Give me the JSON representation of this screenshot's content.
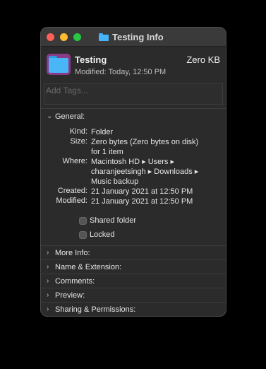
{
  "window": {
    "title": "Testing Info"
  },
  "header": {
    "name": "Testing",
    "size": "Zero KB",
    "modified": "Modified: Today, 12:50 PM"
  },
  "tags": {
    "placeholder": "Add Tags..."
  },
  "general": {
    "label": "General:",
    "rows": [
      {
        "label": "Kind:",
        "lines": [
          "Folder"
        ]
      },
      {
        "label": "Size:",
        "lines": [
          "Zero bytes (Zero bytes on disk)",
          "for 1 item"
        ]
      },
      {
        "label": "Where:",
        "lines": [
          "Macintosh HD ▸ Users ▸",
          "charanjeetsingh ▸ Downloads ▸",
          "Music backup"
        ]
      },
      {
        "label": "Created:",
        "lines": [
          "21 January 2021 at 12:50 PM"
        ]
      },
      {
        "label": "Modified:",
        "lines": [
          "21 January 2021 at 12:50 PM"
        ]
      }
    ],
    "shared_folder_label": "Shared folder",
    "locked_label": "Locked"
  },
  "sections": [
    {
      "label": "More Info:"
    },
    {
      "label": "Name & Extension:"
    },
    {
      "label": "Comments:"
    },
    {
      "label": "Preview:"
    },
    {
      "label": "Sharing & Permissions:"
    }
  ],
  "icons": {
    "collapsed": "chevron-right-icon",
    "expanded": "chevron-down-icon",
    "folder": "folder-icon"
  },
  "colors": {
    "window_bg": "#2b2b2b",
    "folder_blue": "#49b6f7",
    "close": "#ff5f57",
    "minimize": "#febc2e",
    "maximize": "#28c840"
  }
}
